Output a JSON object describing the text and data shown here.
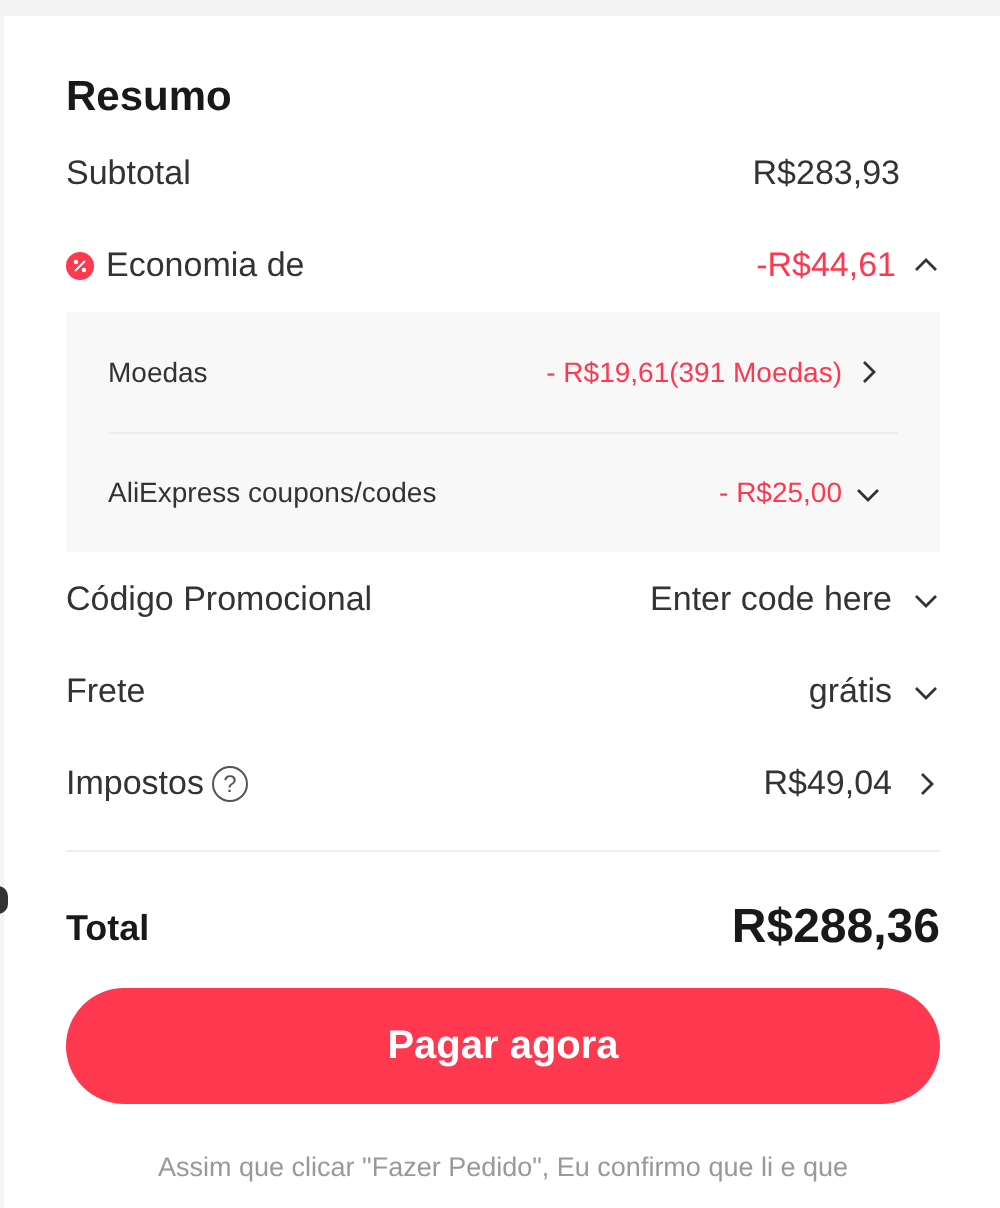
{
  "title": "Resumo",
  "subtotal": {
    "label": "Subtotal",
    "value": "R$283,93"
  },
  "savings": {
    "label": "Economia de",
    "value": "-R$44,61",
    "expanded": true,
    "items": [
      {
        "label": "Moedas",
        "value": "- R$19,61(391 Moedas)",
        "kind": "link"
      },
      {
        "label": "AliExpress coupons/codes",
        "value": "- R$25,00",
        "kind": "dropdown"
      }
    ]
  },
  "rows": [
    {
      "label": "Código Promocional",
      "value": "Enter code here",
      "kind": "dropdown"
    },
    {
      "label": "Frete",
      "value": "grátis",
      "kind": "dropdown"
    },
    {
      "label": "Impostos",
      "value": "R$49,04",
      "kind": "link",
      "help_glyph": "?"
    }
  ],
  "total": {
    "label": "Total",
    "value": "R$288,36"
  },
  "pay_button": "Pagar agora",
  "footer_text": "Assim que clicar \"Fazer Pedido\", Eu confirmo que li e que"
}
